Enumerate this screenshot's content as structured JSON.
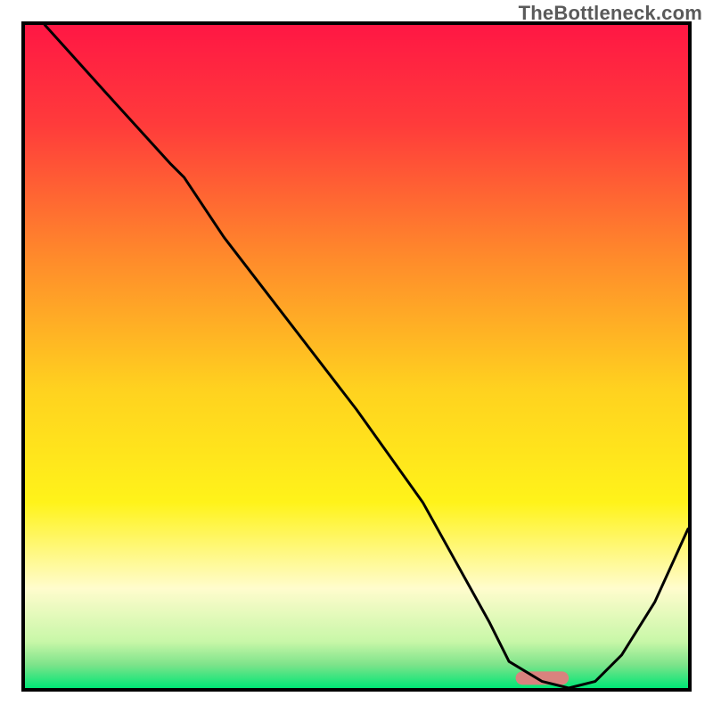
{
  "watermark": "TheBottleneck.com",
  "chart_data": {
    "type": "line",
    "title": "",
    "xlabel": "",
    "ylabel": "",
    "xlim": [
      0,
      100
    ],
    "ylim": [
      0,
      100
    ],
    "x": [
      3,
      12,
      22,
      24,
      30,
      40,
      50,
      60,
      70,
      73,
      78,
      82,
      86,
      90,
      95,
      100
    ],
    "values": [
      100,
      90,
      79,
      77,
      68,
      55,
      42,
      28,
      10,
      4,
      1,
      0,
      1,
      5,
      13,
      24
    ],
    "marker": {
      "x_range": [
        74,
        82
      ],
      "y": 1.5,
      "color": "#d9827e"
    },
    "background_gradient": {
      "stops": [
        {
          "offset": 0.0,
          "color": "#ff1744"
        },
        {
          "offset": 0.15,
          "color": "#ff3b3b"
        },
        {
          "offset": 0.35,
          "color": "#ff8a2b"
        },
        {
          "offset": 0.55,
          "color": "#ffd21f"
        },
        {
          "offset": 0.72,
          "color": "#fff31a"
        },
        {
          "offset": 0.85,
          "color": "#fffccd"
        },
        {
          "offset": 0.93,
          "color": "#c8f7a8"
        },
        {
          "offset": 0.965,
          "color": "#7de38a"
        },
        {
          "offset": 1.0,
          "color": "#00e676"
        }
      ]
    },
    "grid": false,
    "legend": false
  }
}
